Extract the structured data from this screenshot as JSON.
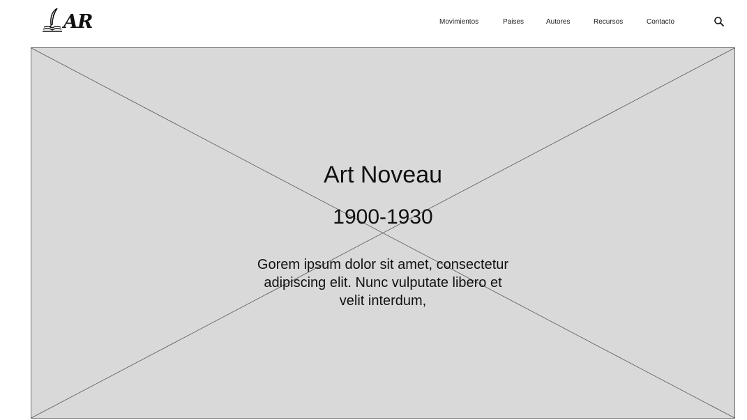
{
  "header": {
    "logo": {
      "icon": "quill-book-icon",
      "text": "AR"
    },
    "nav": [
      {
        "label": "Movimientos"
      },
      {
        "label": "Paises"
      },
      {
        "label": "Autores"
      },
      {
        "label": "Recursos"
      },
      {
        "label": "Contacto"
      }
    ],
    "search_icon": "search-icon"
  },
  "hero": {
    "title": "Art Noveau",
    "years": "1900-1930",
    "description": "Gorem ipsum dolor sit amet, consectetur adipiscing elit. Nunc vulputate libero et velit interdum,"
  },
  "colors": {
    "background": "#ffffff",
    "placeholder_fill": "#d9d9d9",
    "placeholder_stroke": "#6e6e6e",
    "text": "#111111"
  }
}
